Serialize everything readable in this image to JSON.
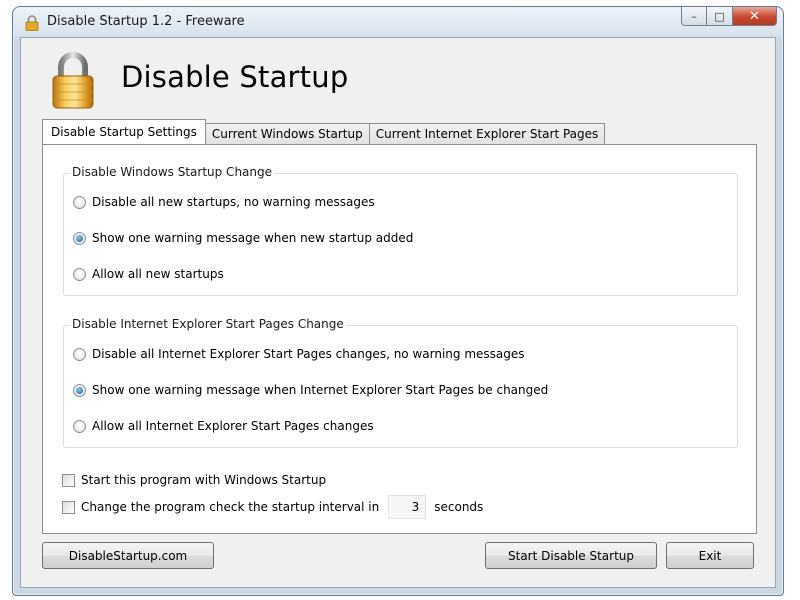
{
  "window": {
    "title": "Disable Startup 1.2 - Freeware",
    "caption_buttons": {
      "minimize": "–",
      "maximize": "□",
      "close": "✕"
    }
  },
  "header": {
    "icon": "lock-icon",
    "title": "Disable Startup"
  },
  "tabs": [
    {
      "label": "Disable Startup Settings",
      "active": true
    },
    {
      "label": "Current Windows Startup",
      "active": false
    },
    {
      "label": "Current Internet Explorer Start Pages",
      "active": false
    }
  ],
  "windows_group": {
    "legend": "Disable Windows Startup Change",
    "options": [
      {
        "label": "Disable all new startups, no warning messages",
        "checked": false
      },
      {
        "label": "Show one warning message when new startup added",
        "checked": true
      },
      {
        "label": "Allow all new startups",
        "checked": false
      }
    ]
  },
  "ie_group": {
    "legend": "Disable Internet Explorer Start Pages Change",
    "options": [
      {
        "label": "Disable all Internet Explorer Start Pages changes, no warning messages",
        "checked": false
      },
      {
        "label": "Show one warning message when Internet Explorer Start Pages be changed",
        "checked": true
      },
      {
        "label": "Allow all Internet Explorer Start Pages changes",
        "checked": false
      }
    ]
  },
  "checks": {
    "start_with_windows": {
      "label": "Start this program with Windows Startup",
      "checked": false
    },
    "interval": {
      "label": "Change the program check the startup interval in",
      "value": "3",
      "unit": "seconds",
      "checked": false
    }
  },
  "buttons": {
    "website": "DisableStartup.com",
    "start": "Start Disable Startup",
    "exit": "Exit"
  },
  "colors": {
    "close_button": "#c7472f",
    "radio_selected": "#1c5d9a",
    "window_frame": "#cbd8e4"
  }
}
